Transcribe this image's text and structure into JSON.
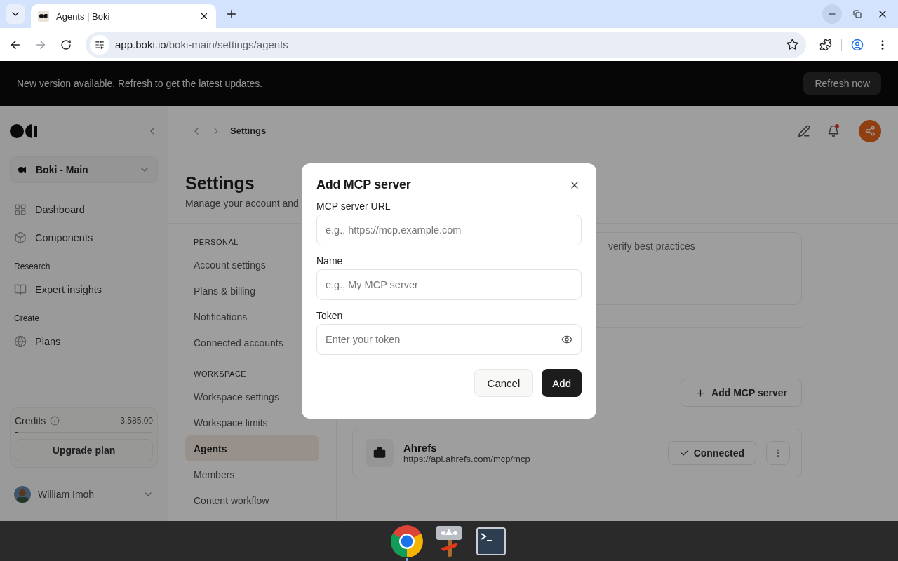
{
  "browser": {
    "tab_title": "Agents | Boki",
    "url_host": "app.boki.io",
    "url_path": "/boki-main/settings/agents"
  },
  "banner": {
    "message": "New version available. Refresh to get the latest updates.",
    "button": "Refresh now"
  },
  "sidebar": {
    "workspace": "Boki - Main",
    "groups": [
      {
        "items": [
          {
            "label": "Dashboard"
          },
          {
            "label": "Components"
          }
        ]
      },
      {
        "heading": "Research",
        "items": [
          {
            "label": "Expert insights"
          }
        ]
      },
      {
        "heading": "Create",
        "items": [
          {
            "label": "Plans"
          }
        ]
      }
    ],
    "credits": {
      "label": "Credits",
      "amount": "3,585.00",
      "level": 0.02,
      "button": "Upgrade plan"
    },
    "user": {
      "name": "William Imoh"
    }
  },
  "header": {
    "breadcrumb": "Settings",
    "notification_dot": true
  },
  "page": {
    "title": "Settings",
    "subtitle": "Manage your account and"
  },
  "settings_nav": [
    {
      "heading": "PERSONAL",
      "items": [
        {
          "label": "Account settings",
          "selected": false
        },
        {
          "label": "Plans & billing",
          "selected": false
        },
        {
          "label": "Notifications",
          "selected": false
        },
        {
          "label": "Connected accounts",
          "selected": false
        }
      ]
    },
    {
      "heading": "WORKSPACE",
      "items": [
        {
          "label": "Workspace settings",
          "selected": false
        },
        {
          "label": "Workspace limits",
          "selected": false
        },
        {
          "label": "Agents",
          "selected": true
        },
        {
          "label": "Members",
          "selected": false
        },
        {
          "label": "Content workflow",
          "selected": false
        }
      ]
    }
  ],
  "content": {
    "card_text": "verify best practices",
    "add_button": "Add MCP server",
    "servers": [
      {
        "name": "Ahrefs",
        "url": "https://api.ahrefs.com/mcp/mcp",
        "status": "Connected"
      }
    ]
  },
  "modal": {
    "title": "Add MCP server",
    "fields": [
      {
        "label": "MCP server URL",
        "placeholder": "e.g., https://mcp.example.com",
        "kind": "text"
      },
      {
        "label": "Name",
        "placeholder": "e.g., My MCP server",
        "kind": "text"
      },
      {
        "label": "Token",
        "placeholder": "Enter your token",
        "kind": "secret"
      }
    ],
    "buttons": [
      {
        "label": "Cancel",
        "kind": "secondary"
      },
      {
        "label": "Add",
        "kind": "primary"
      }
    ]
  },
  "taskbar": {
    "apps": [
      {
        "running": true
      },
      {
        "running": false
      },
      {
        "running": false
      }
    ]
  }
}
